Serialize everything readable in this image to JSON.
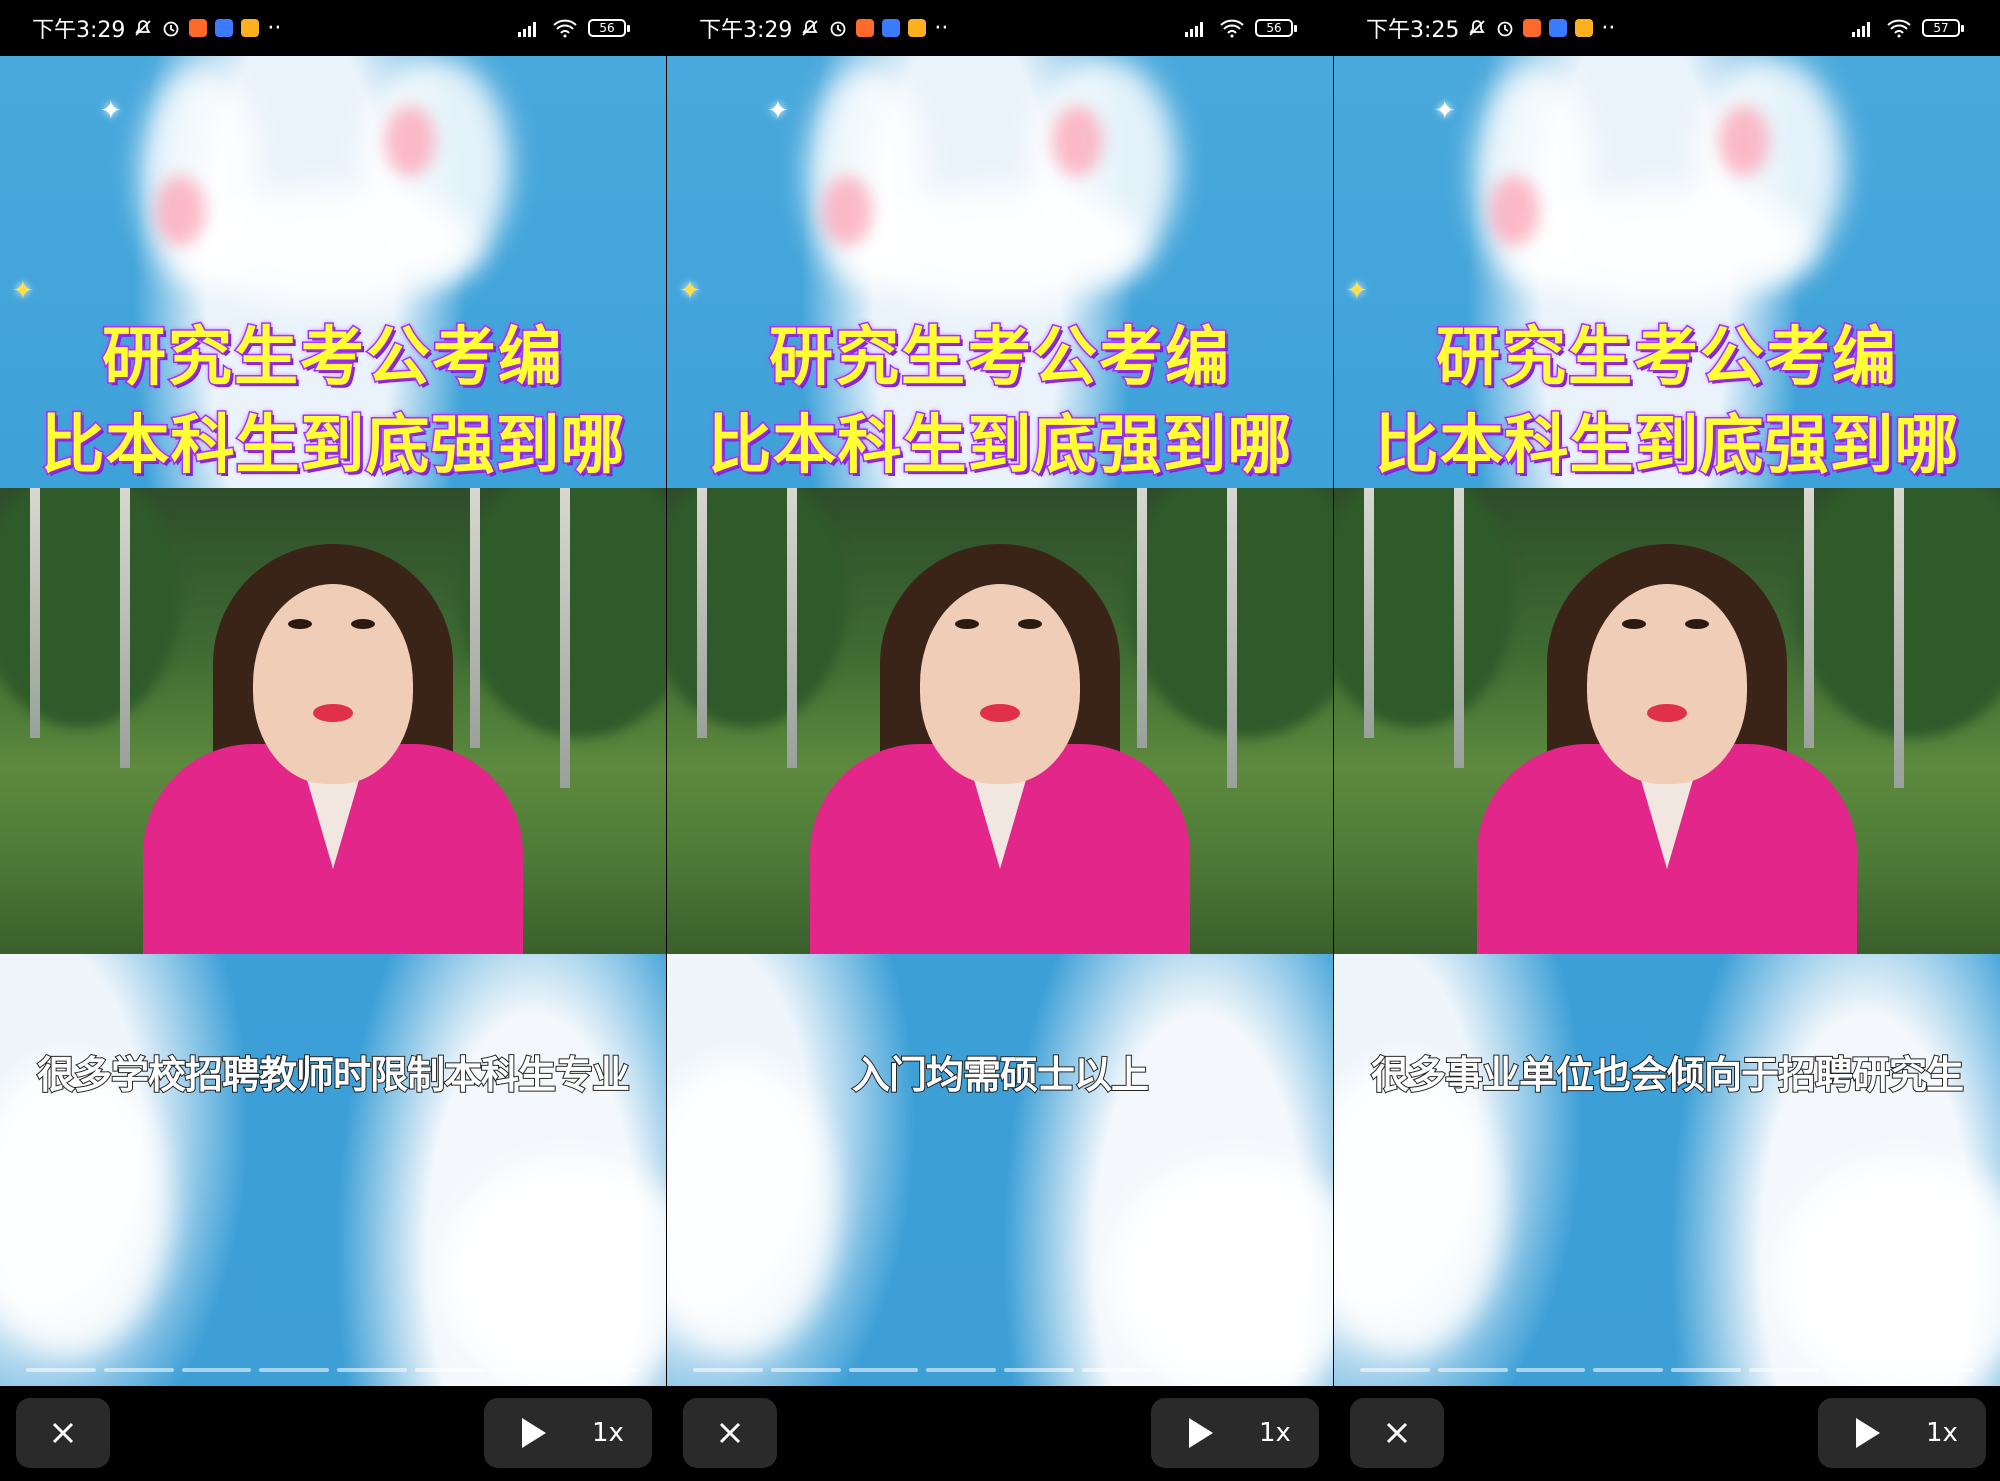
{
  "panels": [
    {
      "status_time": "下午3:29",
      "battery": "56",
      "title_line1": "研究生考公考编",
      "title_line2": "比本科生到底强到哪",
      "subtitle": "很多学校招聘教师时限制本科生专业",
      "speed": "1x"
    },
    {
      "status_time": "下午3:29",
      "battery": "56",
      "title_line1": "研究生考公考编",
      "title_line2": "比本科生到底强到哪",
      "subtitle": "入门均需硕士以上",
      "speed": "1x"
    },
    {
      "status_time": "下午3:25",
      "battery": "57",
      "title_line1": "研究生考公考编",
      "title_line2": "比本科生到底强到哪",
      "subtitle": "很多事业单位也会倾向于招聘研究生",
      "speed": "1x"
    }
  ],
  "status_icons": [
    "mute-icon",
    "alarm-icon",
    "app-notification-icons",
    "more-icon",
    "signal-icon",
    "wifi-icon",
    "battery-icon"
  ],
  "colors": {
    "title_fill": "#ffff33",
    "title_stroke": "#9b2cff",
    "jacket": "#e2268a",
    "sky": "#3aa0d8"
  }
}
